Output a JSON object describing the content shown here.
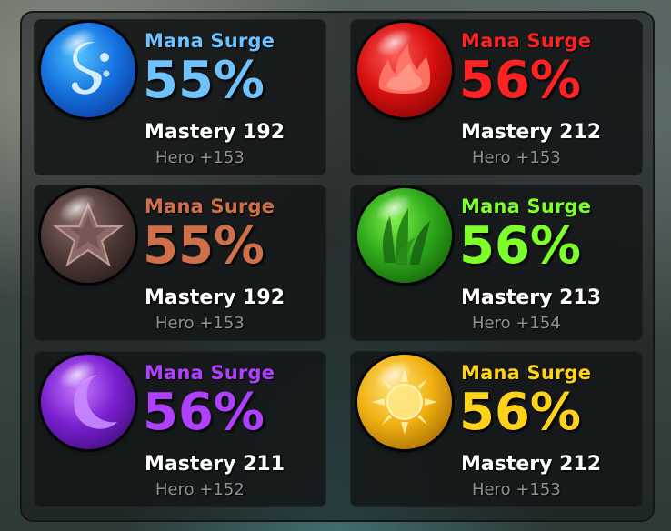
{
  "panel": {
    "cards": [
      {
        "element": "water",
        "icon": "water-drop-icon",
        "color": "#6ec3ff",
        "skill": "Mana Surge",
        "percent": "55%",
        "mastery": "Mastery 192",
        "hero": "Hero +153"
      },
      {
        "element": "fire",
        "icon": "flame-icon",
        "color": "#ff2222",
        "skill": "Mana Surge",
        "percent": "56%",
        "mastery": "Mastery 212",
        "hero": "Hero +153"
      },
      {
        "element": "dark",
        "icon": "star-icon",
        "color": "#d0704a",
        "skill": "Mana Surge",
        "percent": "55%",
        "mastery": "Mastery 192",
        "hero": "Hero +153"
      },
      {
        "element": "nature",
        "icon": "leaf-icon",
        "color": "#7dff2a",
        "skill": "Mana Surge",
        "percent": "56%",
        "mastery": "Mastery 213",
        "hero": "Hero +154"
      },
      {
        "element": "moon",
        "icon": "crescent-moon-icon",
        "color": "#b040ff",
        "skill": "Mana Surge",
        "percent": "56%",
        "mastery": "Mastery 211",
        "hero": "Hero +152"
      },
      {
        "element": "light",
        "icon": "sun-icon",
        "color": "#ffd21a",
        "skill": "Mana Surge",
        "percent": "56%",
        "mastery": "Mastery 212",
        "hero": "Hero +153"
      }
    ]
  }
}
